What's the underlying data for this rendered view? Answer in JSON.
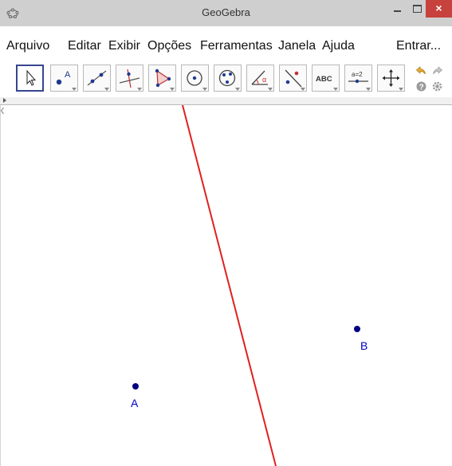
{
  "window": {
    "title": "GeoGebra",
    "close_glyph": "×"
  },
  "menu": {
    "items": [
      "Arquivo",
      "Editar",
      "Exibir",
      "Opções",
      "Ferramentas",
      "Janela",
      "Ajuda"
    ],
    "signin": "Entrar..."
  },
  "toolbar": {
    "tools": [
      {
        "icon": "move-arrow-icon"
      },
      {
        "icon": "point-icon",
        "label": "A"
      },
      {
        "icon": "line-icon"
      },
      {
        "icon": "perpendicular-line-icon"
      },
      {
        "icon": "polygon-icon"
      },
      {
        "icon": "circle-center-icon"
      },
      {
        "icon": "circle-three-points-icon"
      },
      {
        "icon": "angle-icon",
        "label": "α"
      },
      {
        "icon": "reflect-icon"
      },
      {
        "icon": "text-icon",
        "label": "ABC"
      },
      {
        "icon": "slider-icon",
        "label": "a=2"
      },
      {
        "icon": "move-graphics-icon"
      }
    ],
    "side": [
      "undo-icon",
      "redo-icon",
      "help-icon",
      "settings-icon"
    ]
  },
  "graphics": {
    "points": [
      {
        "name": "A",
        "color": "#00007f"
      },
      {
        "name": "B",
        "color": "#00007f"
      }
    ],
    "line_color": "#e02020",
    "label_color": "#0000c8"
  }
}
